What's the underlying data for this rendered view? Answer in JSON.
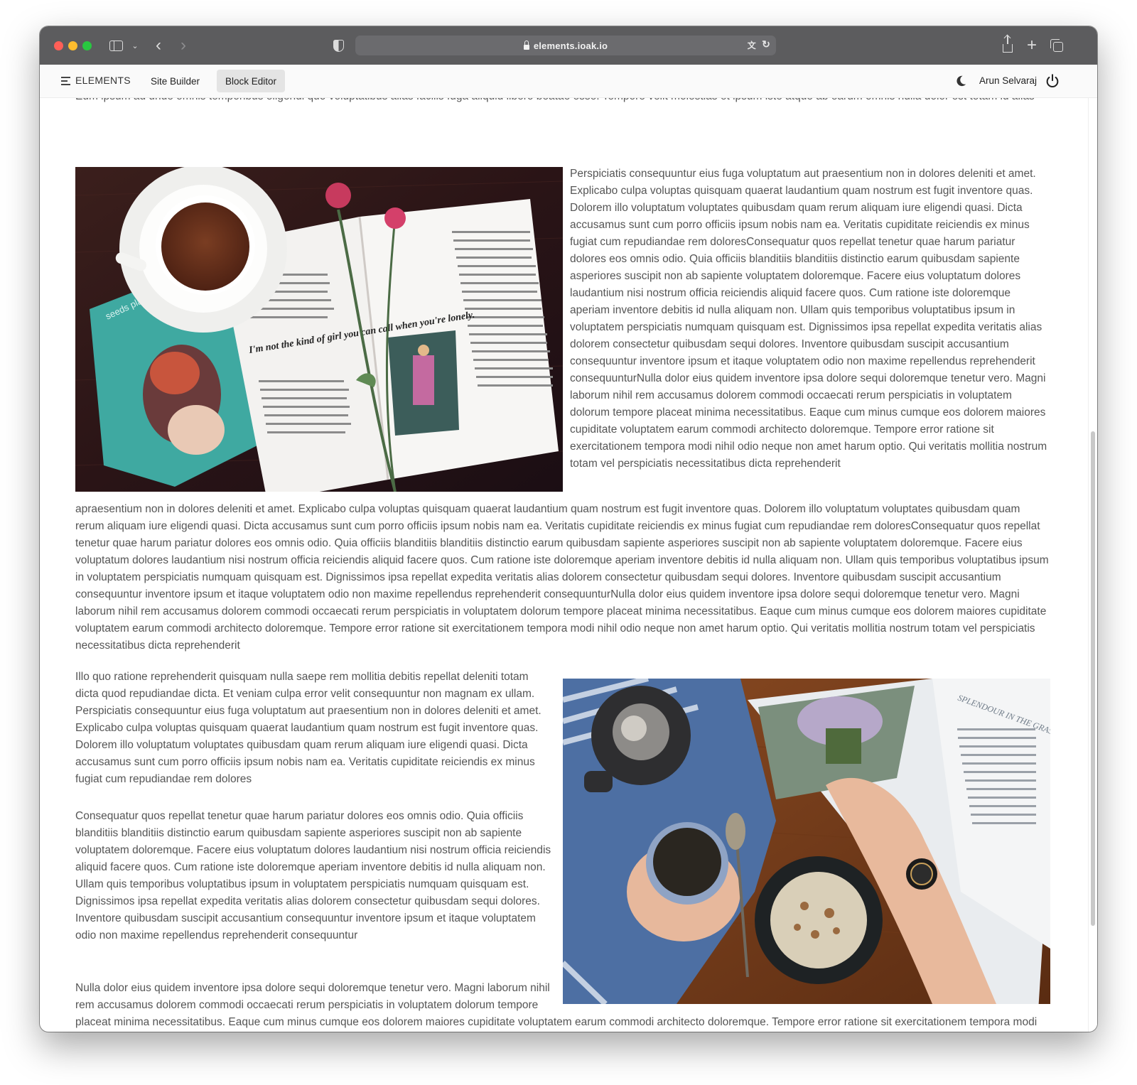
{
  "browser": {
    "url": "elements.ioak.io"
  },
  "app": {
    "brand": "ELEMENTS",
    "nav": [
      "Site Builder",
      "Block Editor"
    ],
    "active_nav": "Block Editor",
    "user_name": "Arun Selvaraj"
  },
  "content": {
    "p_top": "Eum ipsum ad unde omnis temporibus eligendi quo voluptatibus alias facilis fuga aliquid libero beatae esse. Tempore velit molestias et ipsum iste atque ab earum omnis nulla dolor est totam id alias",
    "p_right1": "Perspiciatis consequuntur eius fuga voluptatum aut praesentium non in dolores deleniti et amet. Explicabo culpa voluptas quisquam quaerat laudantium quam nostrum est fugit inventore quas. Dolorem illo voluptatum voluptates quibusdam quam rerum aliquam iure eligendi quasi. Dicta accusamus sunt cum porro officiis ipsum nobis nam ea. Veritatis cupiditate reiciendis ex minus fugiat cum repudiandae rem doloresConsequatur quos repellat tenetur quae harum pariatur dolores eos omnis odio. Quia officiis blanditiis blanditiis distinctio earum quibusdam sapiente asperiores suscipit non ab sapiente voluptatem doloremque. Facere eius voluptatum dolores laudantium nisi nostrum officia reiciendis aliquid facere quos. Cum ratione iste doloremque aperiam inventore debitis id nulla aliquam non. Ullam quis temporibus voluptatibus ipsum in voluptatem perspiciatis numquam quisquam est. Dignissimos ipsa repellat expedita veritatis alias dolorem consectetur quibusdam sequi dolores. Inventore quibusdam suscipit accusantium consequuntur inventore ipsum et itaque voluptatem odio non maxime repellendus reprehenderit consequunturNulla dolor eius quidem inventore ipsa dolore sequi doloremque tenetur vero. Magni laborum nihil rem accusamus dolorem commodi occaecati rerum perspiciatis in voluptatem dolorum tempore placeat minima necessitatibus. Eaque cum minus cumque eos dolorem maiores cupiditate voluptatem earum commodi architecto doloremque. Tempore error ratione sit exercitationem tempora modi nihil odio neque non amet harum optio. Qui veritatis mollitia nostrum totam vel perspiciatis necessitatibus dicta reprehenderit",
    "p_full2": "apraesentium non in dolores deleniti et amet. Explicabo culpa voluptas quisquam quaerat laudantium quam nostrum est fugit inventore quas. Dolorem illo voluptatum voluptates quibusdam quam rerum aliquam iure eligendi quasi. Dicta accusamus sunt cum porro officiis ipsum nobis nam ea. Veritatis cupiditate reiciendis ex minus fugiat cum repudiandae rem doloresConsequatur quos repellat tenetur quae harum pariatur dolores eos omnis odio. Quia officiis blanditiis blanditiis distinctio earum quibusdam sapiente asperiores suscipit non ab sapiente voluptatem doloremque. Facere eius voluptatum dolores laudantium nisi nostrum officia reiciendis aliquid facere quos. Cum ratione iste doloremque aperiam inventore debitis id nulla aliquam non. Ullam quis temporibus voluptatibus ipsum in voluptatem perspiciatis numquam quisquam est. Dignissimos ipsa repellat expedita veritatis alias dolorem consectetur quibusdam sequi dolores. Inventore quibusdam suscipit accusantium consequuntur inventore ipsum et itaque voluptatem odio non maxime repellendus reprehenderit consequunturNulla dolor eius quidem inventore ipsa dolore sequi doloremque tenetur vero. Magni laborum nihil rem accusamus dolorem commodi occaecati rerum perspiciatis in voluptatem dolorum tempore placeat minima necessitatibus. Eaque cum minus cumque eos dolorem maiores cupiditate voluptatem earum commodi architecto doloremque. Tempore error ratione sit exercitationem tempora modi nihil odio neque non amet harum optio. Qui veritatis mollitia nostrum totam vel perspiciatis necessitatibus dicta reprehenderit",
    "p_left1": "Illo quo ratione reprehenderit quisquam nulla saepe rem mollitia debitis repellat deleniti totam dicta quod repudiandae dicta. Et veniam culpa error velit consequuntur non magnam ex ullam. Perspiciatis consequuntur eius fuga voluptatum aut praesentium non in dolores deleniti et amet. Explicabo culpa voluptas quisquam quaerat laudantium quam nostrum est fugit inventore quas. Dolorem illo voluptatum voluptates quibusdam quam rerum aliquam iure eligendi quasi. Dicta accusamus sunt cum porro officiis ipsum nobis nam ea. Veritatis cupiditate reiciendis ex minus fugiat cum repudiandae rem dolores",
    "p_left2": "Consequatur quos repellat tenetur quae harum pariatur dolores eos omnis odio. Quia officiis blanditiis blanditiis distinctio earum quibusdam sapiente asperiores suscipit non ab sapiente voluptatem doloremque. Facere eius voluptatum dolores laudantium nisi nostrum officia reiciendis aliquid facere quos. Cum ratione iste doloremque aperiam inventore debitis id nulla aliquam non. Ullam quis temporibus voluptatibus ipsum in voluptatem perspiciatis numquam quisquam est. Dignissimos ipsa repellat expedita veritatis alias dolorem consectetur quibusdam sequi dolores. Inventore quibusdam suscipit accusantium consequuntur inventore ipsum et itaque voluptatem odio non maxime repellendus reprehenderit consequuntur",
    "p_left3": "Nulla dolor eius quidem inventore ipsa dolore sequi doloremque tenetur vero. Magni laborum nihil rem accusamus dolorem commodi occaecati rerum perspiciatis in voluptatem dolorum tempore placeat minima necessitatibus. Eaque cum minus cumque eos dolorem maiores cupiditate voluptatem earum commodi architecto doloremque. Tempore error ratione sit exercitationem tempora modi nihil odio neque non amet harum optio. Qui veritatis mollitia nostrum totam vel perspiciatis necessitatibus dicta reprehenderit"
  },
  "images": {
    "book_caption": "I'm not the kind of girl you can call when you're lonely.",
    "book_cover_text": "seeds planted in concrete",
    "magazine_title": "SPLENDOUR IN THE GRASS"
  },
  "icons": [
    "sidebar-icon",
    "chevron-left-icon",
    "chevron-right-icon",
    "shield-icon",
    "lock-icon",
    "translate-icon",
    "reload-icon",
    "share-icon",
    "plus-icon",
    "tabs-icon",
    "menu-icon",
    "theme-icon",
    "power-icon"
  ]
}
